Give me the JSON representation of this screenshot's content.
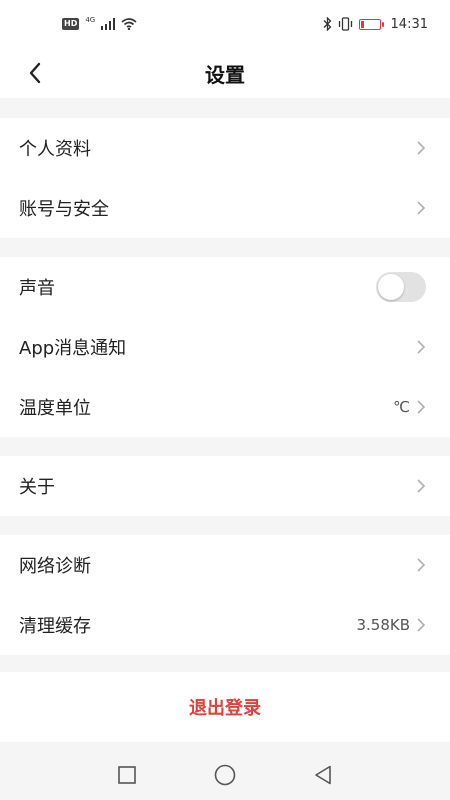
{
  "status_bar": {
    "network_badge": "HD",
    "network_type": "4G",
    "time": "14:31",
    "icons": [
      "signal-icon",
      "wifi-icon",
      "bluetooth-icon",
      "vibrate-icon",
      "battery-icon"
    ],
    "battery_color": "#e23b3b"
  },
  "header": {
    "title": "设置",
    "back_icon": "back-arrow-icon"
  },
  "groups": [
    {
      "items": [
        {
          "label": "个人资料"
        },
        {
          "label": "账号与安全"
        }
      ]
    },
    {
      "items": [
        {
          "label": "声音",
          "toggle": "off"
        },
        {
          "label": "App消息通知"
        },
        {
          "label": "温度单位",
          "value": "℃"
        }
      ]
    },
    {
      "items": [
        {
          "label": "关于"
        }
      ]
    },
    {
      "items": [
        {
          "label": "网络诊断"
        },
        {
          "label": "清理缓存",
          "value": "3.58KB"
        }
      ]
    }
  ],
  "logout": {
    "label": "退出登录",
    "color": "#e0413a"
  },
  "nav_bar": {
    "icons": [
      "recent-apps-icon",
      "home-icon",
      "back-icon"
    ]
  }
}
